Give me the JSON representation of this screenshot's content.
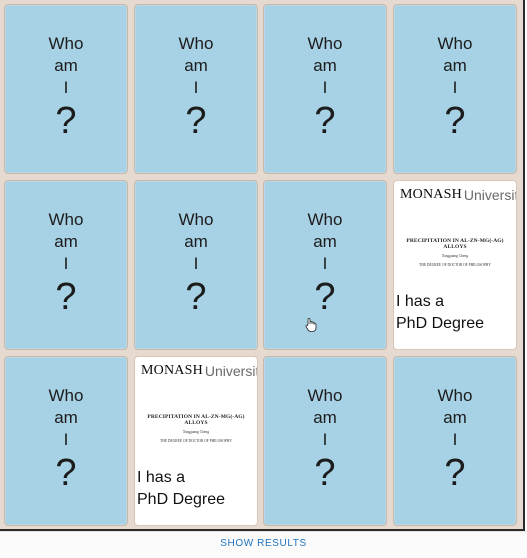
{
  "board": {
    "cards": [
      {
        "state": "back"
      },
      {
        "state": "back"
      },
      {
        "state": "back"
      },
      {
        "state": "back"
      },
      {
        "state": "back"
      },
      {
        "state": "back"
      },
      {
        "state": "back"
      },
      {
        "state": "front"
      },
      {
        "state": "back"
      },
      {
        "state": "front"
      },
      {
        "state": "back"
      },
      {
        "state": "back"
      }
    ]
  },
  "card_back": {
    "line1": "Who",
    "line2": "am",
    "line3": "I",
    "mark": "?"
  },
  "card_front": {
    "brand_bold": "MONASH",
    "brand_light": "University",
    "thesis_title": "PRECIPITATION IN AL-ZN-MG(-AG) ALLOYS",
    "author": "Xingguang Cheng",
    "degree": "THE DEGREE OF DOCTOR OF PHILOSOPHY",
    "caption_line1": "I has a",
    "caption_line2": "PhD Degree"
  },
  "footer": {
    "show_results_label": "SHOW RESULTS"
  },
  "colors": {
    "card_back": "#a7d1e5",
    "board_gap": "#e6dad0",
    "link": "#1e73be"
  },
  "icons": {
    "logo": "monash-shield-icon",
    "cursor": "hand-pointer-icon"
  }
}
